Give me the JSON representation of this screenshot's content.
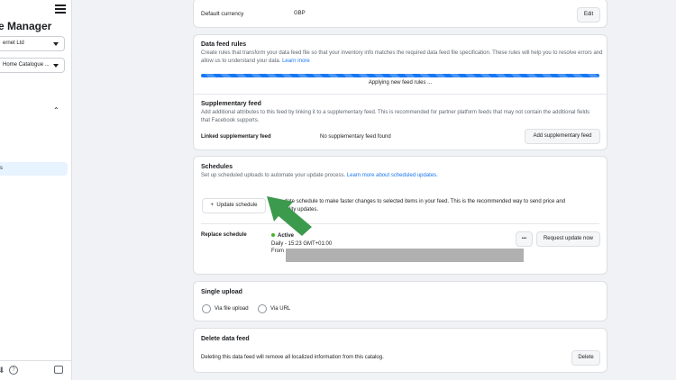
{
  "sidebar": {
    "title": "e Manager",
    "business_select": "ernet Ltd",
    "catalogue_select": "Home Catalogue ...",
    "active_item": "s"
  },
  "currency_card": {
    "label": "Default currency",
    "value": "GBP",
    "edit_label": "Edit"
  },
  "rules_card": {
    "title": "Data feed rules",
    "description": "Create rules that transform your data feed file so that your inventory info matches the required data feed file specification. These rules will help you to resolve errors and allow us to understand your data.",
    "learn_more": "Learn more",
    "status": "Applying new feed rules ..."
  },
  "supplementary_card": {
    "title": "Supplementary feed",
    "description": "Add additional attributes to this feed by linking it to a supplementary feed. This is recommended for partner platform feeds that may not contain the additional fields that Facebook supports.",
    "linked_label": "Linked supplementary feed",
    "linked_value": "No supplementary feed found",
    "add_button": "Add supplementary feed"
  },
  "schedules_card": {
    "title": "Schedules",
    "description": "Set up scheduled uploads to automate your update process.",
    "learn_more": "Learn more about scheduled updates.",
    "update_button": "Update schedule",
    "update_note_a": "U",
    "update_note_b": "date schedule to make faster changes to selected items in your feed. This is the recommended way to send price and",
    "update_note_c": "lity updates.",
    "replace_label": "Replace schedule",
    "status": "Active",
    "frequency": "Daily - 15:23 GMT+01:00",
    "from_label": "From",
    "more_button": "•••",
    "request_button": "Request update now"
  },
  "single_upload_card": {
    "title": "Single upload",
    "option_file": "Via file upload",
    "option_url": "Via URL"
  },
  "delete_card": {
    "title": "Delete data feed",
    "description": "Deleting this data feed will remove all localized information from this catalog.",
    "delete_button": "Delete"
  },
  "colors": {
    "accent": "#1877f2",
    "annotation_arrow": "#3c9a4d",
    "active_status": "#42b72a"
  }
}
